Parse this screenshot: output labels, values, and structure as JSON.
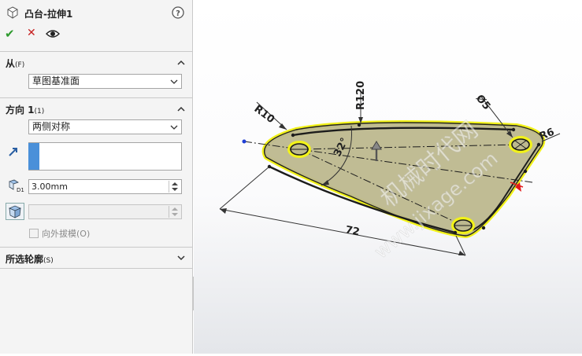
{
  "feature": {
    "title": "凸台-拉伸1",
    "icon": "boss-extrude-cube-icon",
    "help_icon": "question-circle-icon"
  },
  "actions": {
    "ok": "✔",
    "cancel": "✕",
    "preview_icon": "eye-icon"
  },
  "from_section": {
    "title": "从",
    "accel": "(F)",
    "value": "草图基准面"
  },
  "direction_section": {
    "title": "方向 1",
    "accel": "(1)",
    "end_condition": "两侧对称",
    "depth": "3.00mm",
    "draft_outward_label": "向外拔模",
    "draft_outward_accel": "(O)",
    "draft_checked": false
  },
  "contours_section": {
    "title": "所选轮廓",
    "accel": "(S)"
  },
  "sketch": {
    "dimensions": [
      "R10",
      "R120",
      "Ø5",
      "R6",
      "32°",
      "72"
    ],
    "colors": {
      "face": "#bdb98f",
      "highlight": "#f2f21a",
      "edge": "#1c1c1c",
      "dimension": "#333333"
    }
  },
  "watermark": {
    "line1": "机械时代网",
    "line2": "www.jixage.com"
  },
  "colors": {
    "ok": "#2e9a2e",
    "cancel": "#c62020",
    "accent_blue": "#4a90d9"
  }
}
